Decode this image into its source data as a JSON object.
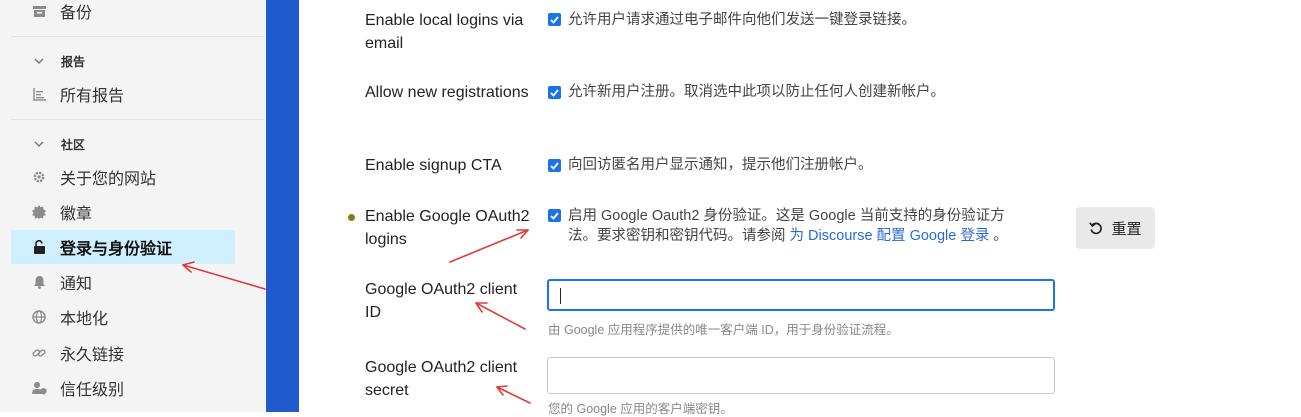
{
  "sidebar": {
    "top_item": {
      "label": "备份",
      "icon": "archive-icon"
    },
    "sections": [
      {
        "title": "报告",
        "items": [
          {
            "label": "所有报告",
            "icon": "chart-list-icon"
          }
        ]
      },
      {
        "title": "社区",
        "items": [
          {
            "label": "关于您的网站",
            "icon": "gear-icon"
          },
          {
            "label": "徽章",
            "icon": "badge-icon"
          },
          {
            "label": "登录与身份验证",
            "icon": "unlock-icon",
            "active": true
          },
          {
            "label": "通知",
            "icon": "bell-icon"
          },
          {
            "label": "本地化",
            "icon": "globe-icon"
          },
          {
            "label": "永久链接",
            "icon": "link-icon"
          },
          {
            "label": "信任级别",
            "icon": "user-shield-icon"
          }
        ]
      }
    ]
  },
  "settings": {
    "local_logins_email": {
      "label": "Enable local logins via email",
      "checked": true,
      "description": "允许用户请求通过电子邮件向他们发送一键登录链接。"
    },
    "new_registrations": {
      "label": "Allow new registrations",
      "checked": true,
      "description": "允许新用户注册。取消选中此项以防止任何人创建新帐户。"
    },
    "signup_cta": {
      "label": "Enable signup CTA",
      "checked": true,
      "description": "向回访匿名用户显示通知，提示他们注册帐户。"
    },
    "google_oauth2": {
      "label": "Enable Google OAuth2 logins",
      "checked": true,
      "description_line1": "启用 Google Oauth2 身份验证。这是 Google 当前支持的身份验证方",
      "description_line2_prefix": "法。要求密钥和密钥代码。请参阅",
      "link_text": "为 Discourse 配置 Google 登录",
      "description_suffix": "。",
      "reset_label": "重置"
    },
    "client_id": {
      "label": "Google OAuth2 client ID",
      "value": "",
      "hint": "由 Google 应用程序提供的唯一客户端 ID，用于身份验证流程。"
    },
    "client_secret": {
      "label": "Google OAuth2 client secret",
      "value": "",
      "hint": "您的 Google 应用的客户端密钥。"
    }
  },
  "colors": {
    "accent": "#1a73e8",
    "stripe": "#1f5bcc",
    "active_nav": "#d1f0ff",
    "annotation_arrow": "#e53935"
  }
}
